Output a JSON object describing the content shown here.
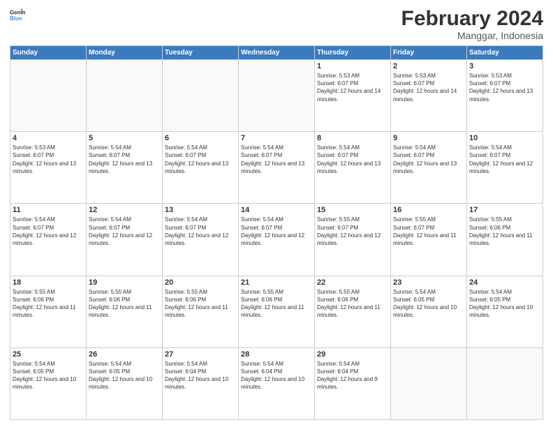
{
  "header": {
    "logo_line1": "General",
    "logo_line2": "Blue",
    "month_title": "February 2024",
    "location": "Manggar, Indonesia"
  },
  "weekdays": [
    "Sunday",
    "Monday",
    "Tuesday",
    "Wednesday",
    "Thursday",
    "Friday",
    "Saturday"
  ],
  "weeks": [
    [
      {
        "day": "",
        "empty": true
      },
      {
        "day": "",
        "empty": true
      },
      {
        "day": "",
        "empty": true
      },
      {
        "day": "",
        "empty": true
      },
      {
        "day": "1",
        "sunrise": "5:53 AM",
        "sunset": "6:07 PM",
        "daylight": "12 hours and 14 minutes."
      },
      {
        "day": "2",
        "sunrise": "5:53 AM",
        "sunset": "6:07 PM",
        "daylight": "12 hours and 14 minutes."
      },
      {
        "day": "3",
        "sunrise": "5:53 AM",
        "sunset": "6:07 PM",
        "daylight": "12 hours and 13 minutes."
      }
    ],
    [
      {
        "day": "4",
        "sunrise": "5:53 AM",
        "sunset": "6:07 PM",
        "daylight": "12 hours and 13 minutes."
      },
      {
        "day": "5",
        "sunrise": "5:54 AM",
        "sunset": "6:07 PM",
        "daylight": "12 hours and 13 minutes."
      },
      {
        "day": "6",
        "sunrise": "5:54 AM",
        "sunset": "6:07 PM",
        "daylight": "12 hours and 13 minutes."
      },
      {
        "day": "7",
        "sunrise": "5:54 AM",
        "sunset": "6:07 PM",
        "daylight": "12 hours and 13 minutes."
      },
      {
        "day": "8",
        "sunrise": "5:54 AM",
        "sunset": "6:07 PM",
        "daylight": "12 hours and 13 minutes."
      },
      {
        "day": "9",
        "sunrise": "5:54 AM",
        "sunset": "6:07 PM",
        "daylight": "12 hours and 13 minutes."
      },
      {
        "day": "10",
        "sunrise": "5:54 AM",
        "sunset": "6:07 PM",
        "daylight": "12 hours and 12 minutes."
      }
    ],
    [
      {
        "day": "11",
        "sunrise": "5:54 AM",
        "sunset": "6:07 PM",
        "daylight": "12 hours and 12 minutes."
      },
      {
        "day": "12",
        "sunrise": "5:54 AM",
        "sunset": "6:07 PM",
        "daylight": "12 hours and 12 minutes."
      },
      {
        "day": "13",
        "sunrise": "5:54 AM",
        "sunset": "6:07 PM",
        "daylight": "12 hours and 12 minutes."
      },
      {
        "day": "14",
        "sunrise": "5:54 AM",
        "sunset": "6:07 PM",
        "daylight": "12 hours and 12 minutes."
      },
      {
        "day": "15",
        "sunrise": "5:55 AM",
        "sunset": "6:07 PM",
        "daylight": "12 hours and 12 minutes."
      },
      {
        "day": "16",
        "sunrise": "5:55 AM",
        "sunset": "6:07 PM",
        "daylight": "12 hours and 11 minutes."
      },
      {
        "day": "17",
        "sunrise": "5:55 AM",
        "sunset": "6:06 PM",
        "daylight": "12 hours and 11 minutes."
      }
    ],
    [
      {
        "day": "18",
        "sunrise": "5:55 AM",
        "sunset": "6:06 PM",
        "daylight": "12 hours and 11 minutes."
      },
      {
        "day": "19",
        "sunrise": "5:55 AM",
        "sunset": "6:06 PM",
        "daylight": "12 hours and 11 minutes."
      },
      {
        "day": "20",
        "sunrise": "5:55 AM",
        "sunset": "6:06 PM",
        "daylight": "12 hours and 11 minutes."
      },
      {
        "day": "21",
        "sunrise": "5:55 AM",
        "sunset": "6:06 PM",
        "daylight": "12 hours and 11 minutes."
      },
      {
        "day": "22",
        "sunrise": "5:55 AM",
        "sunset": "6:06 PM",
        "daylight": "12 hours and 11 minutes."
      },
      {
        "day": "23",
        "sunrise": "5:54 AM",
        "sunset": "6:05 PM",
        "daylight": "12 hours and 10 minutes."
      },
      {
        "day": "24",
        "sunrise": "5:54 AM",
        "sunset": "6:05 PM",
        "daylight": "12 hours and 10 minutes."
      }
    ],
    [
      {
        "day": "25",
        "sunrise": "5:54 AM",
        "sunset": "6:05 PM",
        "daylight": "12 hours and 10 minutes."
      },
      {
        "day": "26",
        "sunrise": "5:54 AM",
        "sunset": "6:05 PM",
        "daylight": "12 hours and 10 minutes."
      },
      {
        "day": "27",
        "sunrise": "5:54 AM",
        "sunset": "6:04 PM",
        "daylight": "12 hours and 10 minutes."
      },
      {
        "day": "28",
        "sunrise": "5:54 AM",
        "sunset": "6:04 PM",
        "daylight": "12 hours and 10 minutes."
      },
      {
        "day": "29",
        "sunrise": "5:54 AM",
        "sunset": "6:04 PM",
        "daylight": "12 hours and 9 minutes."
      },
      {
        "day": "",
        "empty": true
      },
      {
        "day": "",
        "empty": true
      }
    ]
  ]
}
